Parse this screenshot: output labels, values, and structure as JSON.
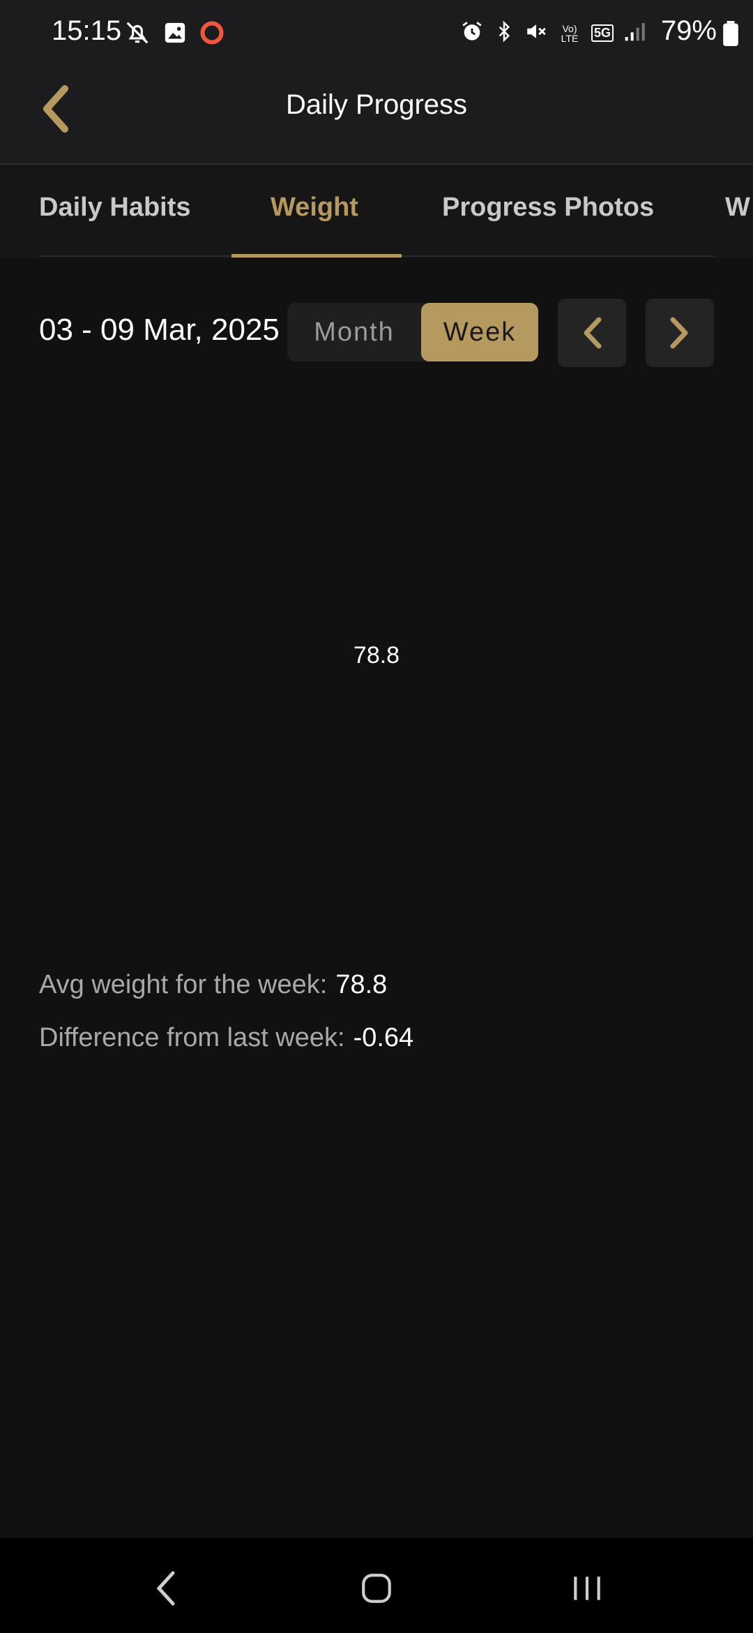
{
  "status_bar": {
    "time": "15:15",
    "battery": "79%",
    "left_icons": [
      "notifications-off-icon",
      "gallery-icon",
      "record-icon"
    ],
    "right_icons": [
      "alarm-icon",
      "bluetooth-icon",
      "mute-icon",
      "volte-icon",
      "5g-icon",
      "signal-icon",
      "battery-icon"
    ],
    "volte_text": "Vo) LTE",
    "network_text": "5G"
  },
  "header": {
    "title": "Daily Progress",
    "back_icon": "chevron-left-icon"
  },
  "tabs": [
    {
      "label": "Daily Habits",
      "active": false
    },
    {
      "label": "Weight",
      "active": true
    },
    {
      "label": "Progress Photos",
      "active": false
    },
    {
      "label": "W",
      "active": false
    }
  ],
  "date_range": "03 - 09 Mar, 2025",
  "period_toggle": {
    "month_label": "Month",
    "week_label": "Week",
    "selected": "Week"
  },
  "nav": {
    "prev_icon": "chevron-left-icon",
    "next_icon": "chevron-right-icon"
  },
  "chart": {
    "value_label": "78.8"
  },
  "stats": {
    "avg_label": "Avg weight for the week:",
    "avg_value": "78.8",
    "diff_label": "Difference from last week:",
    "diff_value": "-0.64"
  },
  "system_nav": {
    "back_icon": "back-icon",
    "home_icon": "home-icon",
    "recents_icon": "recents-icon"
  },
  "colors": {
    "accent": "#b6995e",
    "background": "#111111",
    "header": "#1c1c1e"
  }
}
